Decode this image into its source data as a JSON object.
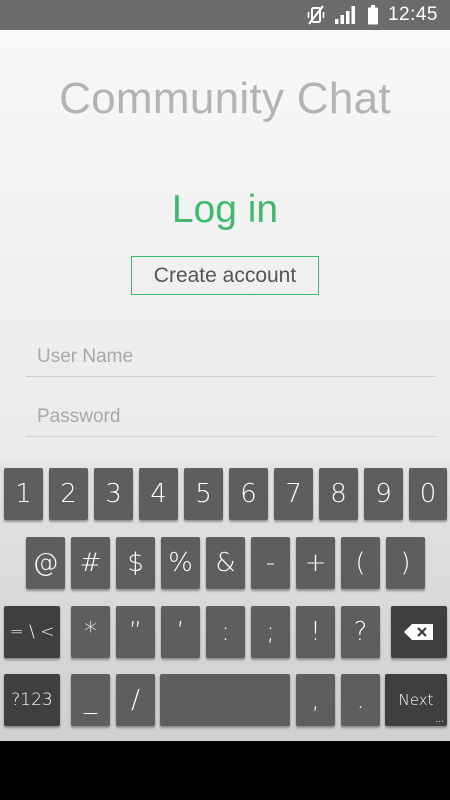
{
  "status_bar": {
    "time": "12:45",
    "icons": [
      "vibrate-mute-icon",
      "signal-icon",
      "battery-icon"
    ]
  },
  "app": {
    "title": "Community Chat",
    "login_heading": "Log in",
    "create_account_label": "Create account",
    "username": {
      "placeholder": "User Name",
      "value": ""
    },
    "password": {
      "placeholder": "Password",
      "value": ""
    }
  },
  "keyboard": {
    "row1": [
      "1",
      "2",
      "3",
      "4",
      "5",
      "6",
      "7",
      "8",
      "9",
      "0"
    ],
    "row2": [
      "@",
      "#",
      "$",
      "%",
      "&",
      "-",
      "+",
      "(",
      ")"
    ],
    "row3": {
      "symbols_toggle": "= \\ <",
      "keys": [
        "*",
        "”",
        "’",
        ":",
        ";",
        "!",
        "?"
      ],
      "backspace_icon": "backspace-icon"
    },
    "row4": {
      "mode_toggle": "?123",
      "underscore": "_",
      "slash": "/",
      "space": "",
      "comma": ",",
      "period": ".",
      "next": "Next",
      "next_hint": "..."
    }
  },
  "colors": {
    "accent": "#3fb96b",
    "status_bar": "#6b6b6b",
    "key": "#5e5e5e",
    "key_dark": "#3f3f3f"
  }
}
